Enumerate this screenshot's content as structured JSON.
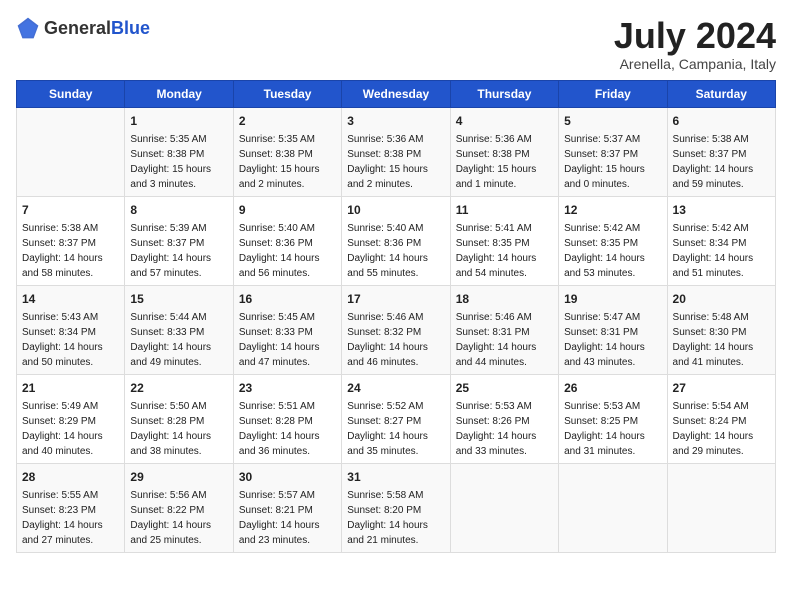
{
  "logo": {
    "general": "General",
    "blue": "Blue"
  },
  "header": {
    "month": "July 2024",
    "location": "Arenella, Campania, Italy"
  },
  "days_of_week": [
    "Sunday",
    "Monday",
    "Tuesday",
    "Wednesday",
    "Thursday",
    "Friday",
    "Saturday"
  ],
  "weeks": [
    [
      {
        "day": "",
        "sunrise": "",
        "sunset": "",
        "daylight": ""
      },
      {
        "day": "1",
        "sunrise": "Sunrise: 5:35 AM",
        "sunset": "Sunset: 8:38 PM",
        "daylight": "Daylight: 15 hours and 3 minutes."
      },
      {
        "day": "2",
        "sunrise": "Sunrise: 5:35 AM",
        "sunset": "Sunset: 8:38 PM",
        "daylight": "Daylight: 15 hours and 2 minutes."
      },
      {
        "day": "3",
        "sunrise": "Sunrise: 5:36 AM",
        "sunset": "Sunset: 8:38 PM",
        "daylight": "Daylight: 15 hours and 2 minutes."
      },
      {
        "day": "4",
        "sunrise": "Sunrise: 5:36 AM",
        "sunset": "Sunset: 8:38 PM",
        "daylight": "Daylight: 15 hours and 1 minute."
      },
      {
        "day": "5",
        "sunrise": "Sunrise: 5:37 AM",
        "sunset": "Sunset: 8:37 PM",
        "daylight": "Daylight: 15 hours and 0 minutes."
      },
      {
        "day": "6",
        "sunrise": "Sunrise: 5:38 AM",
        "sunset": "Sunset: 8:37 PM",
        "daylight": "Daylight: 14 hours and 59 minutes."
      }
    ],
    [
      {
        "day": "7",
        "sunrise": "Sunrise: 5:38 AM",
        "sunset": "Sunset: 8:37 PM",
        "daylight": "Daylight: 14 hours and 58 minutes."
      },
      {
        "day": "8",
        "sunrise": "Sunrise: 5:39 AM",
        "sunset": "Sunset: 8:37 PM",
        "daylight": "Daylight: 14 hours and 57 minutes."
      },
      {
        "day": "9",
        "sunrise": "Sunrise: 5:40 AM",
        "sunset": "Sunset: 8:36 PM",
        "daylight": "Daylight: 14 hours and 56 minutes."
      },
      {
        "day": "10",
        "sunrise": "Sunrise: 5:40 AM",
        "sunset": "Sunset: 8:36 PM",
        "daylight": "Daylight: 14 hours and 55 minutes."
      },
      {
        "day": "11",
        "sunrise": "Sunrise: 5:41 AM",
        "sunset": "Sunset: 8:35 PM",
        "daylight": "Daylight: 14 hours and 54 minutes."
      },
      {
        "day": "12",
        "sunrise": "Sunrise: 5:42 AM",
        "sunset": "Sunset: 8:35 PM",
        "daylight": "Daylight: 14 hours and 53 minutes."
      },
      {
        "day": "13",
        "sunrise": "Sunrise: 5:42 AM",
        "sunset": "Sunset: 8:34 PM",
        "daylight": "Daylight: 14 hours and 51 minutes."
      }
    ],
    [
      {
        "day": "14",
        "sunrise": "Sunrise: 5:43 AM",
        "sunset": "Sunset: 8:34 PM",
        "daylight": "Daylight: 14 hours and 50 minutes."
      },
      {
        "day": "15",
        "sunrise": "Sunrise: 5:44 AM",
        "sunset": "Sunset: 8:33 PM",
        "daylight": "Daylight: 14 hours and 49 minutes."
      },
      {
        "day": "16",
        "sunrise": "Sunrise: 5:45 AM",
        "sunset": "Sunset: 8:33 PM",
        "daylight": "Daylight: 14 hours and 47 minutes."
      },
      {
        "day": "17",
        "sunrise": "Sunrise: 5:46 AM",
        "sunset": "Sunset: 8:32 PM",
        "daylight": "Daylight: 14 hours and 46 minutes."
      },
      {
        "day": "18",
        "sunrise": "Sunrise: 5:46 AM",
        "sunset": "Sunset: 8:31 PM",
        "daylight": "Daylight: 14 hours and 44 minutes."
      },
      {
        "day": "19",
        "sunrise": "Sunrise: 5:47 AM",
        "sunset": "Sunset: 8:31 PM",
        "daylight": "Daylight: 14 hours and 43 minutes."
      },
      {
        "day": "20",
        "sunrise": "Sunrise: 5:48 AM",
        "sunset": "Sunset: 8:30 PM",
        "daylight": "Daylight: 14 hours and 41 minutes."
      }
    ],
    [
      {
        "day": "21",
        "sunrise": "Sunrise: 5:49 AM",
        "sunset": "Sunset: 8:29 PM",
        "daylight": "Daylight: 14 hours and 40 minutes."
      },
      {
        "day": "22",
        "sunrise": "Sunrise: 5:50 AM",
        "sunset": "Sunset: 8:28 PM",
        "daylight": "Daylight: 14 hours and 38 minutes."
      },
      {
        "day": "23",
        "sunrise": "Sunrise: 5:51 AM",
        "sunset": "Sunset: 8:28 PM",
        "daylight": "Daylight: 14 hours and 36 minutes."
      },
      {
        "day": "24",
        "sunrise": "Sunrise: 5:52 AM",
        "sunset": "Sunset: 8:27 PM",
        "daylight": "Daylight: 14 hours and 35 minutes."
      },
      {
        "day": "25",
        "sunrise": "Sunrise: 5:53 AM",
        "sunset": "Sunset: 8:26 PM",
        "daylight": "Daylight: 14 hours and 33 minutes."
      },
      {
        "day": "26",
        "sunrise": "Sunrise: 5:53 AM",
        "sunset": "Sunset: 8:25 PM",
        "daylight": "Daylight: 14 hours and 31 minutes."
      },
      {
        "day": "27",
        "sunrise": "Sunrise: 5:54 AM",
        "sunset": "Sunset: 8:24 PM",
        "daylight": "Daylight: 14 hours and 29 minutes."
      }
    ],
    [
      {
        "day": "28",
        "sunrise": "Sunrise: 5:55 AM",
        "sunset": "Sunset: 8:23 PM",
        "daylight": "Daylight: 14 hours and 27 minutes."
      },
      {
        "day": "29",
        "sunrise": "Sunrise: 5:56 AM",
        "sunset": "Sunset: 8:22 PM",
        "daylight": "Daylight: 14 hours and 25 minutes."
      },
      {
        "day": "30",
        "sunrise": "Sunrise: 5:57 AM",
        "sunset": "Sunset: 8:21 PM",
        "daylight": "Daylight: 14 hours and 23 minutes."
      },
      {
        "day": "31",
        "sunrise": "Sunrise: 5:58 AM",
        "sunset": "Sunset: 8:20 PM",
        "daylight": "Daylight: 14 hours and 21 minutes."
      },
      {
        "day": "",
        "sunrise": "",
        "sunset": "",
        "daylight": ""
      },
      {
        "day": "",
        "sunrise": "",
        "sunset": "",
        "daylight": ""
      },
      {
        "day": "",
        "sunrise": "",
        "sunset": "",
        "daylight": ""
      }
    ]
  ]
}
